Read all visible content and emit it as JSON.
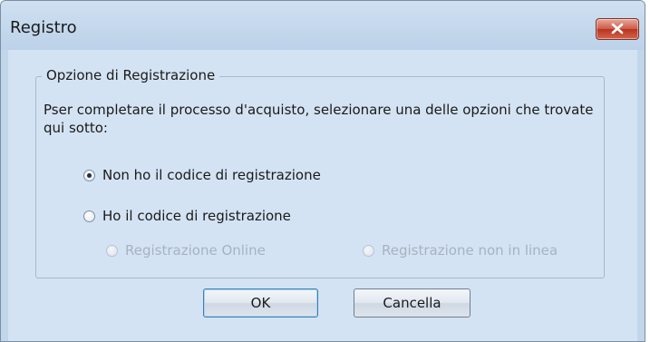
{
  "window": {
    "title": "Registro",
    "close_icon": "close-x-icon"
  },
  "group": {
    "legend": "Opzione di Registrazione",
    "instruction": "Pser completare il processo d'acquisto, selezionare una delle opzioni che trovate qui sotto:"
  },
  "options": {
    "no_code": {
      "label": "Non ho il codice di registrazione",
      "checked": true
    },
    "have_code": {
      "label": "Ho il codice di registrazione",
      "checked": false
    },
    "online": {
      "label": "Registrazione Online",
      "enabled": false
    },
    "offline": {
      "label": "Registrazione non in linea",
      "enabled": false
    }
  },
  "buttons": {
    "ok": "OK",
    "cancel": "Cancella"
  },
  "colors": {
    "dialog_bg": "#d4e3f3",
    "titlebar": "#bcd2e9",
    "close_button": "#c8452e",
    "disabled_text": "#a6b2c0"
  }
}
